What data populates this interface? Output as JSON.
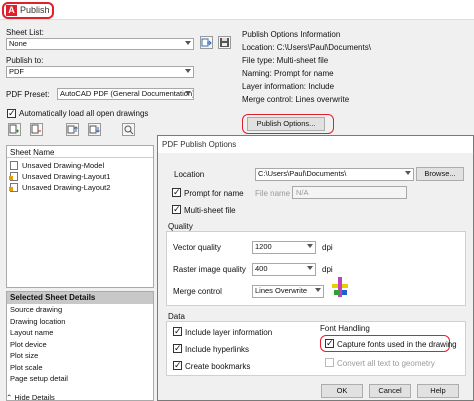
{
  "window": {
    "title": "Publish"
  },
  "left": {
    "sheet_list_label": "Sheet List:",
    "sheet_list_value": "None",
    "publish_to_label": "Publish to:",
    "publish_to_value": "PDF",
    "pdf_preset_label": "PDF Preset:",
    "pdf_preset_value": "AutoCAD PDF (General Documentation)",
    "auto_load_label": "Automatically load all open drawings",
    "auto_load_checked": true,
    "sheet_name_header": "Sheet Name",
    "sheets": [
      "Unsaved Drawing-Model",
      "Unsaved Drawing-Layout1",
      "Unsaved Drawing-Layout2"
    ],
    "details_header": "Selected Sheet Details",
    "details_rows": [
      "Source drawing",
      "Drawing location",
      "Layout name",
      "Plot device",
      "Plot size",
      "Plot scale",
      "Page setup detail"
    ],
    "hide_details": "Hide Details"
  },
  "info": {
    "header": "Publish Options Information",
    "location": "Location: C:\\Users\\Paul\\Documents\\",
    "file_type": "File type: Multi-sheet file",
    "naming": "Naming: Prompt for name",
    "layer_info": "Layer information: Include",
    "merge_control": "Merge control: Lines overwrite",
    "options_button": "Publish Options..."
  },
  "dialog": {
    "title": "PDF Publish Options",
    "location_label": "Location",
    "location_value": "C:\\Users\\Paul\\Documents\\",
    "browse_button": "Browse...",
    "prompt_name_label": "Prompt for name",
    "file_name_label": "File name",
    "file_name_value": "N/A",
    "multi_sheet_label": "Multi-sheet file",
    "quality_header": "Quality",
    "vector_label": "Vector quality",
    "vector_value": "1200",
    "raster_label": "Raster image quality",
    "raster_value": "400",
    "dpi_unit": "dpi",
    "merge_label": "Merge control",
    "merge_value": "Lines Overwrite",
    "data_header": "Data",
    "layer_label": "Include layer information",
    "hyperlinks_label": "Include hyperlinks",
    "bookmarks_label": "Create bookmarks",
    "font_header": "Font Handling",
    "capture_fonts_label": "Capture fonts used in the drawing",
    "convert_text_label": "Convert all text to geometry",
    "ok_button": "OK",
    "cancel_button": "Cancel",
    "help_button": "Help"
  },
  "colors": {
    "highlight": "#e0202a",
    "accent": "#0078d7"
  }
}
